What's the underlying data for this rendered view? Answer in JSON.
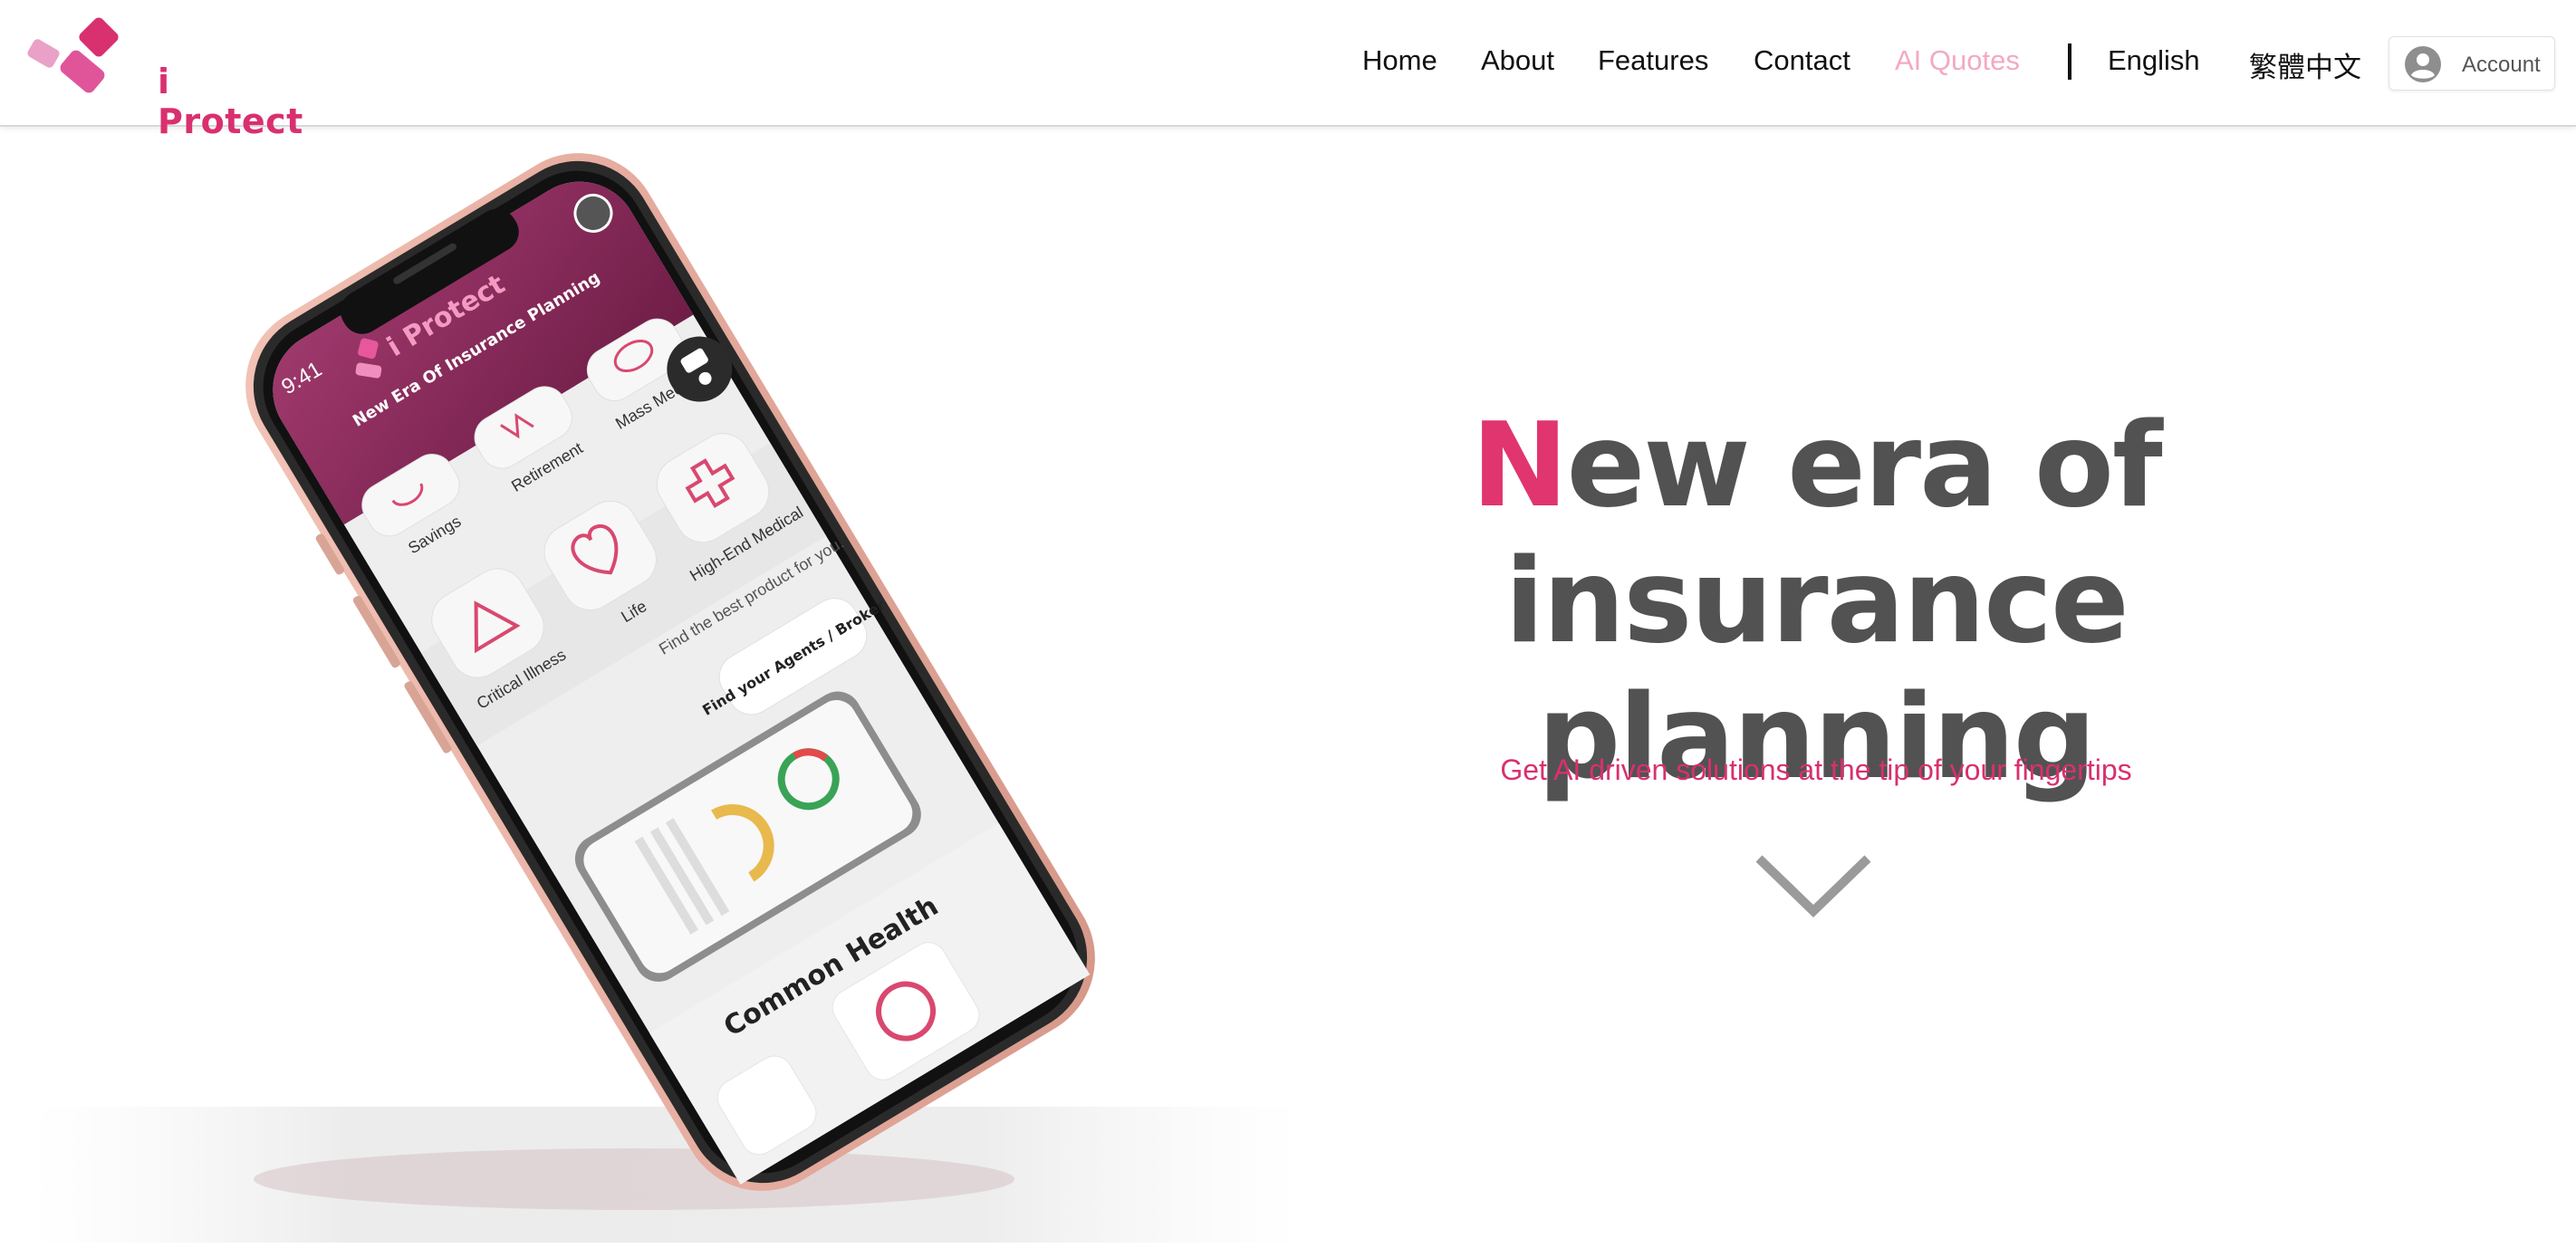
{
  "brand": {
    "name": "i Protect",
    "accent_color": "#d9306f",
    "logo_icon": "diamond-blocks-logo"
  },
  "nav": {
    "items": [
      {
        "label": "Home"
      },
      {
        "label": "About"
      },
      {
        "label": "Features"
      },
      {
        "label": "Contact"
      },
      {
        "label": "AI Quotes"
      }
    ],
    "languages": [
      {
        "label": "English"
      },
      {
        "label": "繁體中文"
      }
    ],
    "account": {
      "label": "Account",
      "icon": "user-circle-icon"
    }
  },
  "hero": {
    "title_first_letter": "N",
    "title_rest_line1": "ew era of insurance",
    "title_line2": "planning",
    "subtitle": "Get AI driven solutions at the tip of your fingertips",
    "scroll_icon": "chevron-down-icon",
    "title_color": "#525252",
    "accent_color": "#e0356f"
  },
  "phone_screen": {
    "time": "9:41",
    "app_name": "i Protect",
    "tagline": "New Era Of Insurance Planning",
    "categories": [
      {
        "label": "Savings"
      },
      {
        "label": "Retirement"
      },
      {
        "label": "Mass Medical"
      },
      {
        "label": "Critical Illness"
      },
      {
        "label": "Life"
      },
      {
        "label": "High-End Medical"
      }
    ],
    "promo_text": "Find the best product for you.",
    "agents_button": "Find your Agents / Broker",
    "section_title": "Common Health"
  }
}
